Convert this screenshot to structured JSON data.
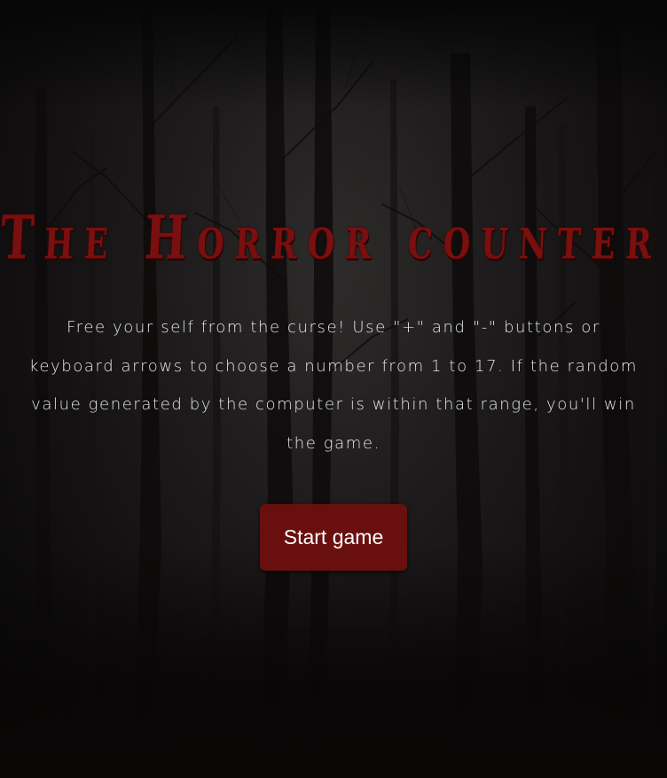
{
  "game": {
    "title": "The Horror counter",
    "description": "Free your self from the curse! Use \"+\" and \"-\" buttons or keyboard arrows to choose a number from 1 to 17. If the random value generated by the computer is within that range, you'll win the game.",
    "start_button_label": "Start game"
  },
  "colors": {
    "title": "#7a0f0f",
    "button_background": "#6a0f0f",
    "text": "#e6e6e6",
    "background": "#1d1b1b"
  }
}
